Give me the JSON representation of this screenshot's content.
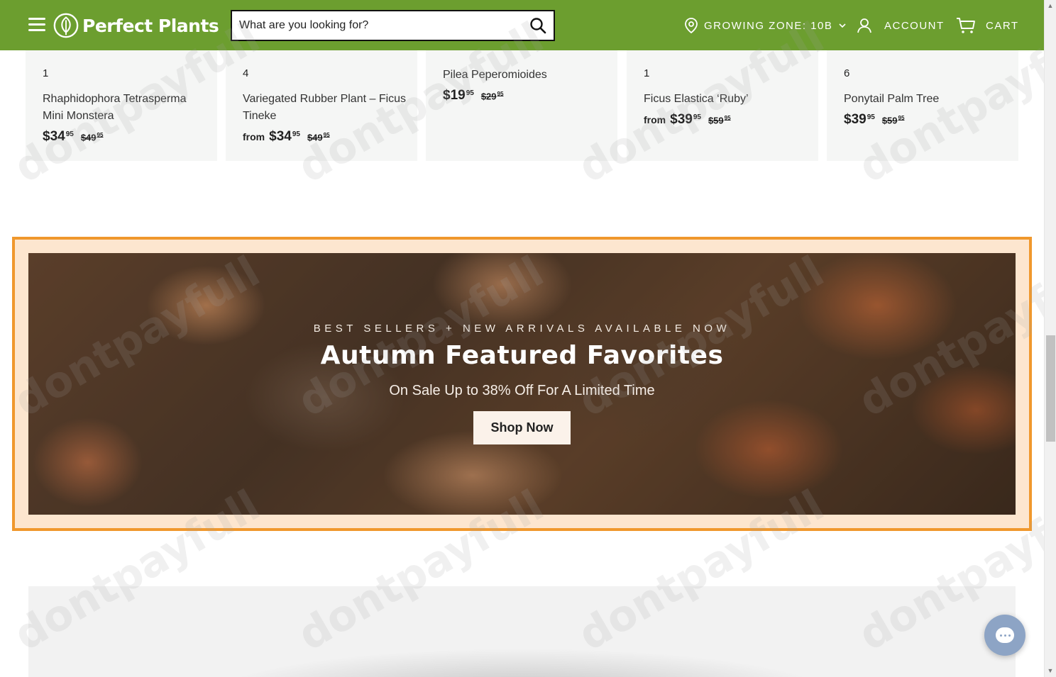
{
  "header": {
    "brand": "Perfect Plants",
    "search_placeholder": "What are you looking for?",
    "zone_label": "GROWING ZONE: 10B",
    "account_label": "ACCOUNT",
    "cart_label": "CART",
    "accent_color": "#6c9e2f"
  },
  "products": [
    {
      "count": "1",
      "name": "Rhaphidophora Tetrasperma Mini Monstera",
      "from": "",
      "price": "$34",
      "price_cents": "95",
      "was": "$49",
      "was_cents": "95"
    },
    {
      "count": "4",
      "name": "Variegated Rubber Plant – Ficus Tineke",
      "from": "from",
      "price": "$34",
      "price_cents": "95",
      "was": "$49",
      "was_cents": "95"
    },
    {
      "count": "",
      "name": "Pilea Peperomioides",
      "from": "",
      "price": "$19",
      "price_cents": "95",
      "was": "$29",
      "was_cents": "95"
    },
    {
      "count": "1",
      "name": "Ficus Elastica ‘Ruby’",
      "from": "from",
      "price": "$39",
      "price_cents": "95",
      "was": "$59",
      "was_cents": "95"
    },
    {
      "count": "6",
      "name": "Ponytail Palm Tree",
      "from": "",
      "price": "$39",
      "price_cents": "95",
      "was": "$59",
      "was_cents": "95"
    }
  ],
  "banner": {
    "eyebrow": "BEST SELLERS + NEW ARRIVALS AVAILABLE NOW",
    "headline": "Autumn Featured Favorites",
    "subhead": "On Sale Up to 38% Off For A Limited Time",
    "cta": "Shop Now",
    "frame_color": "#f0982d"
  },
  "watermark": "dontpayfull",
  "icons": [
    "menu-icon",
    "leaf-logo-icon",
    "search-icon",
    "location-pin-icon",
    "chevron-down-icon",
    "user-icon",
    "cart-icon",
    "chat-icon"
  ]
}
